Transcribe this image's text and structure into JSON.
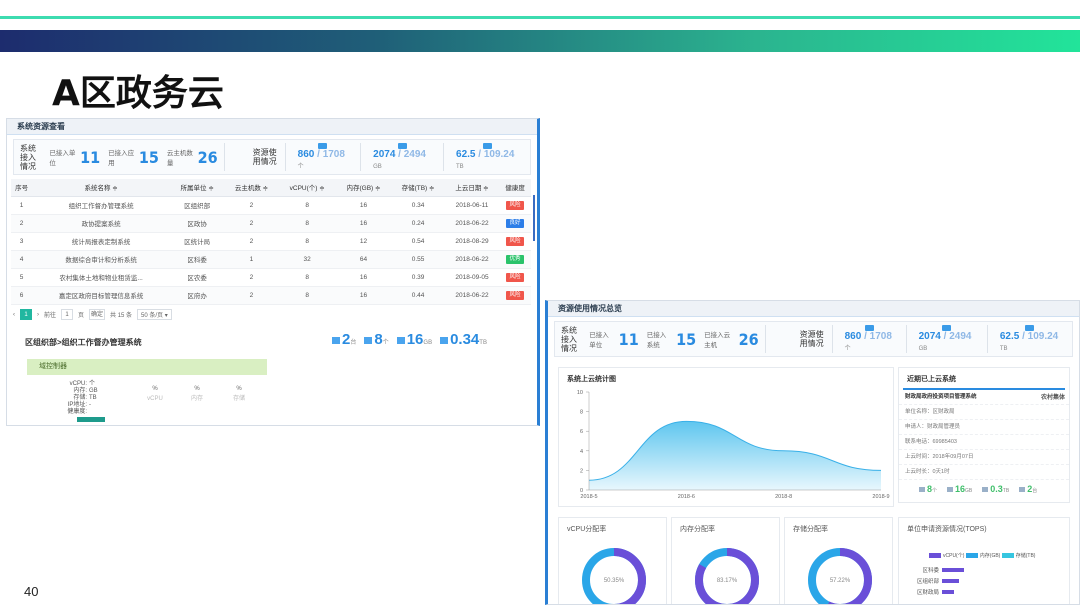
{
  "slide": {
    "title": "A区政务云",
    "page_number": "40"
  },
  "panel1": {
    "header": "系统资源查看",
    "access_label": "系统接入情况",
    "unit_label": "已接入单位",
    "unit_value": "11",
    "app_label": "已接入应用",
    "app_value": "15",
    "host_label": "云主机数量",
    "host_value": "26",
    "resource_label": "资源使用情况",
    "cpu_used": "860",
    "cpu_total": "1708",
    "cpu_unit": "个",
    "mem_used": "2074",
    "mem_total": "2494",
    "mem_unit": "GB",
    "disk_used": "62.5",
    "disk_total": "109.24",
    "disk_unit": "TB",
    "columns": [
      "序号",
      "系统名称 ≑",
      "所属单位 ≑",
      "云主机数 ≑",
      "vCPU(个) ≑",
      "内存(GB) ≑",
      "存储(TB) ≑",
      "上云日期 ≑",
      "健康度"
    ],
    "rows": [
      {
        "no": "1",
        "name": "组织工作督办管理系统",
        "unit": "区组织部",
        "hosts": "2",
        "vcpu": "8",
        "mem": "16",
        "disk": "0.34",
        "date": "2018-06-11",
        "health": "风险",
        "color": "#f0564b"
      },
      {
        "no": "2",
        "name": "政协提案系统",
        "unit": "区政协",
        "hosts": "2",
        "vcpu": "8",
        "mem": "16",
        "disk": "0.24",
        "date": "2018-06-22",
        "health": "良好",
        "color": "#2d7ee8"
      },
      {
        "no": "3",
        "name": "统计局报表定制系统",
        "unit": "区统计局",
        "hosts": "2",
        "vcpu": "8",
        "mem": "12",
        "disk": "0.54",
        "date": "2018-08-29",
        "health": "风险",
        "color": "#f0564b"
      },
      {
        "no": "4",
        "name": "数据综合审计和分析系统",
        "unit": "区科委",
        "hosts": "1",
        "vcpu": "32",
        "mem": "64",
        "disk": "0.55",
        "date": "2018-06-22",
        "health": "优秀",
        "color": "#2bc36b"
      },
      {
        "no": "5",
        "name": "农村集体土地和物业租赁监...",
        "unit": "区农委",
        "hosts": "2",
        "vcpu": "8",
        "mem": "16",
        "disk": "0.39",
        "date": "2018-09-05",
        "health": "风险",
        "color": "#f0564b"
      },
      {
        "no": "6",
        "name": "嘉定区政府目标管理信息系统",
        "unit": "区府办",
        "hosts": "2",
        "vcpu": "8",
        "mem": "16",
        "disk": "0.44",
        "date": "2018-06-22",
        "health": "风险",
        "color": "#f0564b"
      }
    ],
    "pager": {
      "page": "1",
      "goto_label": "前往",
      "page_input": "1",
      "page_suffix": "页",
      "confirm": "确定",
      "total": "共 15 条",
      "per_page": "50 条/页 ▾"
    },
    "breadcrumb": "区组织部>组织工作督办管理系统",
    "detail_hosts": "2",
    "detail_hosts_unit": "台",
    "detail_cpu": "8",
    "detail_cpu_unit": "个",
    "detail_mem": "16",
    "detail_mem_unit": "GB",
    "detail_disk": "0.34",
    "detail_disk_unit": "TB",
    "domain_label": "域控制器",
    "detail_keys": [
      "vCPU:",
      "内存:",
      "存储:",
      "IP地址:",
      "健康度:"
    ],
    "detail_vals": [
      "个",
      "GB",
      "TB",
      "-",
      ""
    ],
    "pct_cols": [
      {
        "v": "%",
        "l": "vCPU"
      },
      {
        "v": "%",
        "l": "内存"
      },
      {
        "v": "%",
        "l": "存储"
      }
    ]
  },
  "panel2": {
    "header": "资源使用情况总览",
    "access_label": "系统接入情况",
    "unit_label": "已接入单位",
    "unit_value": "11",
    "sys_label": "已接入系统",
    "sys_value": "15",
    "host_label": "已接入云主机",
    "host_value": "26",
    "resource_label": "资源使用情况",
    "cpu_used": "860",
    "cpu_total": "1708",
    "cpu_unit": "个",
    "mem_used": "2074",
    "mem_total": "2494",
    "mem_unit": "GB",
    "disk_used": "62.5",
    "disk_total": "109.24",
    "disk_unit": "TB",
    "chart_title": "系统上云统计图",
    "recent_title": "近期已上云系统",
    "recent_rows": [
      "财政局政府投资项目管理系统",
      "单位名称：区财政局",
      "申请人：财政局管理员",
      "联系电话：69985403",
      "上云时间：2018年09月07日",
      "上云时长：0天1时"
    ],
    "recent_side": "农村集体",
    "recent_stats": [
      {
        "v": "8",
        "u": "个"
      },
      {
        "v": "16",
        "u": "GB"
      },
      {
        "v": "0.3",
        "u": "TB"
      },
      {
        "v": "2",
        "u": "台"
      }
    ],
    "donut_titles": [
      "vCPU分配率",
      "内存分配率",
      "存储分配率"
    ],
    "donut_labels": [
      "50.35%",
      "83.17%",
      "57.22%"
    ],
    "unit_req_title": "单位申请资源情况(TOPS)",
    "unit_req_legend": [
      "vCPU(个)",
      "内存(GB)",
      "存储(TB)"
    ],
    "unit_req_rows": [
      "区科委",
      "区组织部",
      "区财政局"
    ]
  },
  "chart_data": {
    "type": "area",
    "title": "系统上云统计图",
    "x": [
      "2018-5",
      "2018-6",
      "2018-8",
      "2018-9"
    ],
    "series": [
      {
        "values": [
          1,
          7,
          4,
          2
        ]
      }
    ],
    "ylim": [
      0,
      10
    ],
    "yticks": [
      "0",
      "2",
      "4",
      "6",
      "8",
      "10"
    ]
  },
  "donuts": [
    0.5035,
    0.8317,
    0.5722
  ],
  "colors": {
    "accent": "#2a8be0",
    "teal": "#21b7a0",
    "donut": "#6a4fd8",
    "donut_bg": "#2aa6e8"
  }
}
